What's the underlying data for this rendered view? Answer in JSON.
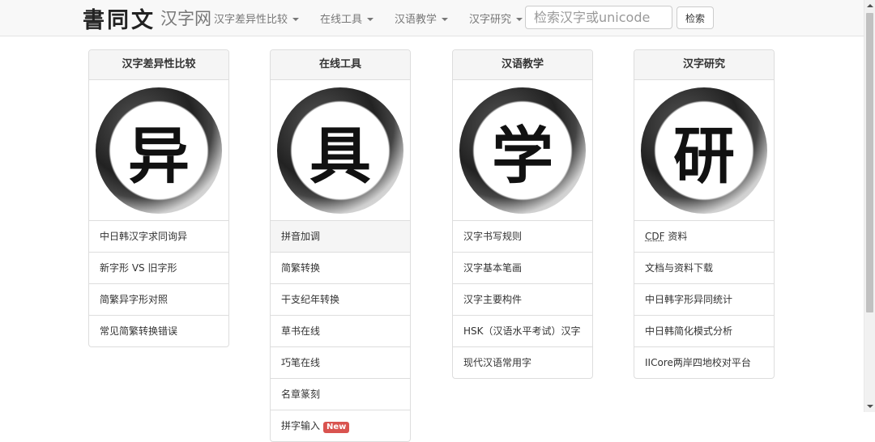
{
  "navbar": {
    "brand_logo": "書同文",
    "brand_text": "汉字网",
    "menu": [
      {
        "label": "汉字差异性比较"
      },
      {
        "label": "在线工具"
      },
      {
        "label": "汉语教学"
      },
      {
        "label": "汉字研究"
      }
    ],
    "search_placeholder": "检索汉字或unicode",
    "search_button": "检索"
  },
  "panels": [
    {
      "heading": "汉字差异性比较",
      "glyph": "异",
      "items": [
        "中日韩汉字求同询异",
        "新字形 VS 旧字形",
        "简繁异字形对照",
        "常见简繁转换错误"
      ]
    },
    {
      "heading": "在线工具",
      "glyph": "具",
      "items": [
        "拼音加调",
        "简繁转换",
        "干支纪年转换",
        "草书在线",
        "巧笔在线",
        "名章篆刻",
        "拼字输入"
      ],
      "badge": "New"
    },
    {
      "heading": "汉语教学",
      "glyph": "学",
      "items": [
        "汉字书写规则",
        "汉字基本笔画",
        "汉字主要构件",
        "HSK（汉语水平考试）汉字",
        "现代汉语常用字"
      ]
    },
    {
      "heading": "汉字研究",
      "glyph": "研",
      "items": [
        "CDF",
        "资料",
        "文档与资料下载",
        "中日韩字形异同统计",
        "中日韩简化模式分析",
        "IICore两岸四地校对平台"
      ]
    }
  ]
}
